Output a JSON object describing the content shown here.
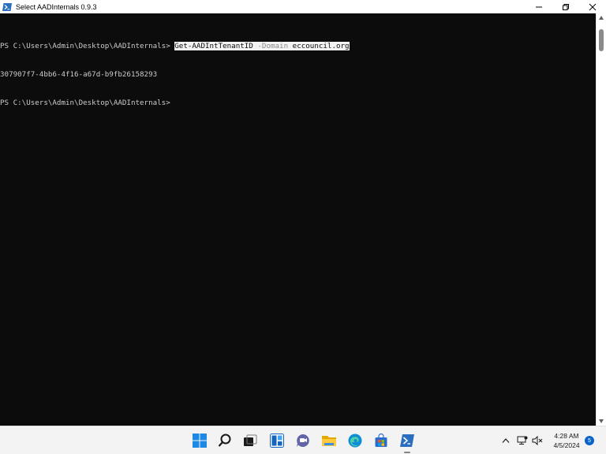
{
  "window": {
    "title": "Select AADInternals 0.9.3"
  },
  "console": {
    "lines": [
      {
        "prompt": "PS C:\\Users\\Admin\\Desktop\\AADInternals> ",
        "cmdlet": "Get-AADIntTenantID",
        "param": "-Domain",
        "arg": "eccouncil.org"
      },
      {
        "text": "307907f7-4bb6-4f16-a67d-b9fb26158293"
      },
      {
        "prompt": "PS C:\\Users\\Admin\\Desktop\\AADInternals> "
      }
    ]
  },
  "taskbar": {
    "icons": [
      "windows-start-icon",
      "search-icon",
      "task-view-icon",
      "widgets-icon",
      "teams-chat-icon",
      "file-explorer-icon",
      "edge-icon",
      "store-icon",
      "powershell-icon"
    ],
    "clock_time": "4:28 AM",
    "clock_date": "4/5/2024",
    "notification_count": "5"
  },
  "colors": {
    "console_bg": "#0c0c0c",
    "console_fg": "#cccccc",
    "param_fg": "#767676",
    "accent": "#0a64c8"
  }
}
